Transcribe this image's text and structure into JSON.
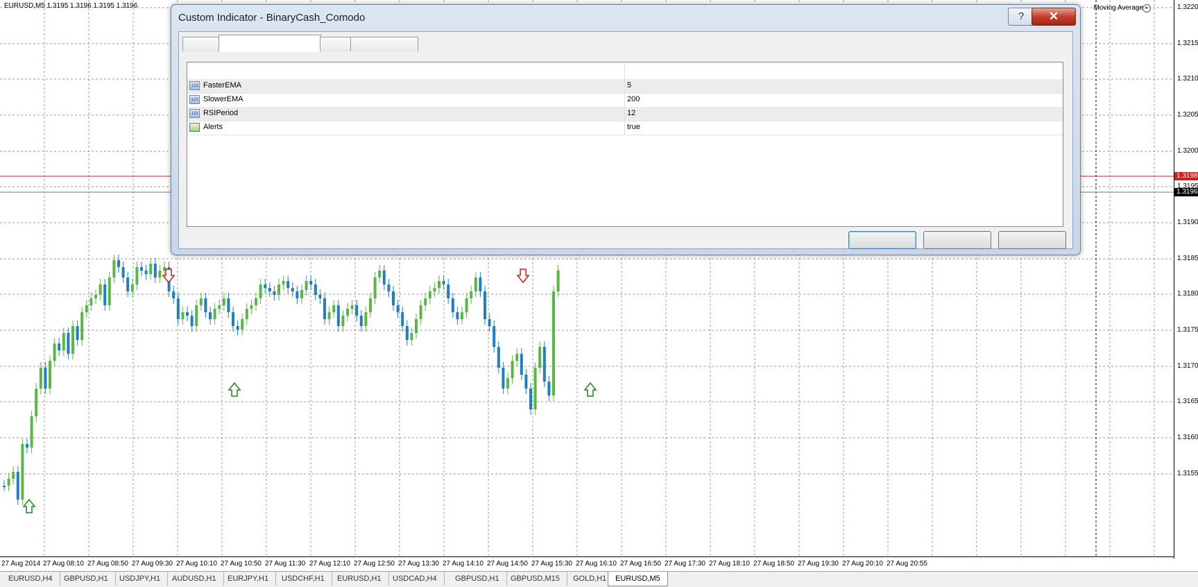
{
  "chart": {
    "symbol_info": "EURUSD,M5  1.3195 1.3196 1.3195 1.3196",
    "indicator_label": "Moving Average",
    "bid_price": "1.3198",
    "current_price": "1.3196",
    "price_ticks": [
      "1.3220",
      "1.3215",
      "1.3210",
      "1.3205",
      "1.3200",
      "1.3195",
      "1.3190",
      "1.3185",
      "1.3180",
      "1.3175",
      "1.3170",
      "1.3165",
      "1.3160",
      "1.3155"
    ],
    "time_ticks": [
      "27 Aug 2014",
      "27 Aug 08:10",
      "27 Aug 08:50",
      "27 Aug 09:30",
      "27 Aug 10:10",
      "27 Aug 10:50",
      "27 Aug 11:30",
      "27 Aug 12:10",
      "27 Aug 12:50",
      "27 Aug 13:30",
      "27 Aug 14:10",
      "27 Aug 14:50",
      "27 Aug 15:30",
      "27 Aug 16:10",
      "27 Aug 16:50",
      "27 Aug 17:30",
      "27 Aug 18:10",
      "27 Aug 18:50",
      "27 Aug 19:30",
      "27 Aug 20:10",
      "27 Aug 20:55"
    ],
    "colors": {
      "bull": "#5ab645",
      "bear": "#1f7fc1",
      "grid": "#9a9a9a",
      "bid_line": "#d01f1f",
      "up_arrow": "#1a8c1a",
      "down_arrow": "#d01f1f"
    }
  },
  "symbol_tabs": [
    "EURUSD,H4",
    "GBPUSD,H1",
    "USDJPY,H1",
    "AUDUSD,H1",
    "EURJPY,H1",
    "USDCHF,H1",
    "EURUSD,H1",
    "USDCAD,H4",
    "GBPUSD,H1",
    "GBPUSD,M15",
    "GOLD,H1",
    "EURUSD,M5"
  ],
  "active_tab": "EURUSD,M5",
  "dialog": {
    "title": "Custom Indicator - BinaryCash_Comodo",
    "help_label": "?",
    "close_label": "✕",
    "inputs": [
      {
        "name": "FasterEMA",
        "value": "5",
        "icon": "int-icon"
      },
      {
        "name": "SlowerEMA",
        "value": "200",
        "icon": "int-icon"
      },
      {
        "name": "RSIPeriod",
        "value": "12",
        "icon": "int-icon"
      },
      {
        "name": "Alerts",
        "value": "true",
        "icon": "bool-icon"
      }
    ]
  }
}
